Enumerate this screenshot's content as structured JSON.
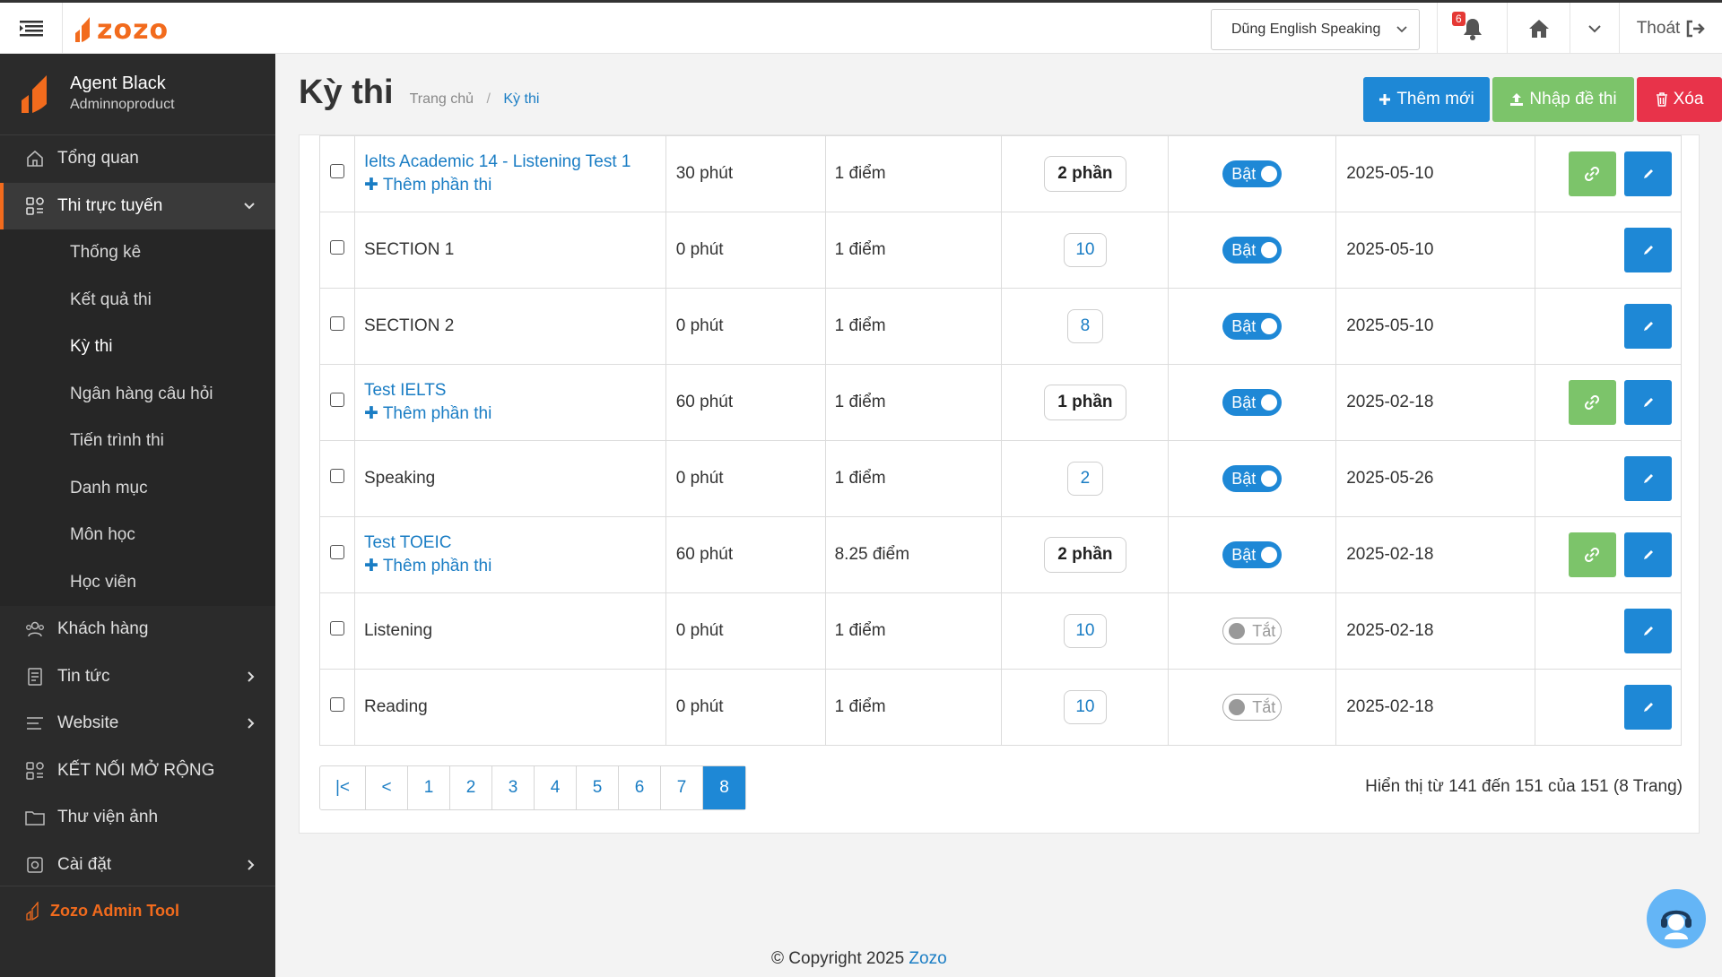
{
  "header": {
    "logo_text": "zozo",
    "site_select": "Dũng English Speaking",
    "notification_count": "6",
    "logout_label": "Thoát"
  },
  "sidebar": {
    "user_name": "Agent Black",
    "user_role": "Adminnoproduct",
    "items": [
      {
        "label": "Tổng quan"
      },
      {
        "label": "Thi trực tuyến"
      },
      {
        "label": "Khách hàng"
      },
      {
        "label": "Tin tức"
      },
      {
        "label": "Website"
      },
      {
        "label": "KẾT NỐI MỞ RỘNG"
      },
      {
        "label": "Thư viện ảnh"
      },
      {
        "label": "Cài đặt"
      }
    ],
    "sub_items": [
      {
        "label": "Thống kê"
      },
      {
        "label": "Kết quả thi"
      },
      {
        "label": "Kỳ thi"
      },
      {
        "label": "Ngân hàng câu hỏi"
      },
      {
        "label": "Tiến trình thi"
      },
      {
        "label": "Danh mục"
      },
      {
        "label": "Môn học"
      },
      {
        "label": "Học viên"
      }
    ],
    "footer_label": "Zozo Admin Tool"
  },
  "page": {
    "title": "Kỳ thi",
    "breadcrumb_home": "Trang chủ",
    "breadcrumb_sep": "/",
    "breadcrumb_current": "Kỳ thi",
    "btn_add": "Thêm mới",
    "btn_import": "Nhập đề thi",
    "btn_delete": "Xóa"
  },
  "table": {
    "add_part_label": "Thêm phần thi",
    "rows": [
      {
        "name": "Ielts Academic 14 - Listening Test 1",
        "time": "30 phút",
        "score": "1 điểm",
        "parts": "2 phần",
        "status": "Bật",
        "date": "2025-05-10"
      },
      {
        "name": "SECTION 1",
        "time": "0 phút",
        "score": "1 điểm",
        "parts": "10",
        "status": "Bật",
        "date": "2025-05-10"
      },
      {
        "name": "SECTION 2",
        "time": "0 phút",
        "score": "1 điểm",
        "parts": "8",
        "status": "Bật",
        "date": "2025-05-10"
      },
      {
        "name": "Test IELTS",
        "time": "60 phút",
        "score": "1 điểm",
        "parts": "1 phần",
        "status": "Bật",
        "date": "2025-02-18"
      },
      {
        "name": "Speaking",
        "time": "0 phút",
        "score": "1 điểm",
        "parts": "2",
        "status": "Bật",
        "date": "2025-05-26"
      },
      {
        "name": "Test TOEIC",
        "time": "60 phút",
        "score": "8.25 điểm",
        "parts": "2 phần",
        "status": "Bật",
        "date": "2025-02-18"
      },
      {
        "name": "Listening",
        "time": "0 phút",
        "score": "1 điểm",
        "parts": "10",
        "status": "Tắt",
        "date": "2025-02-18"
      },
      {
        "name": "Reading",
        "time": "0 phút",
        "score": "1 điểm",
        "parts": "10",
        "status": "Tắt",
        "date": "2025-02-18"
      }
    ]
  },
  "pagination": {
    "first": "|<",
    "prev": "<",
    "pages": [
      "1",
      "2",
      "3",
      "4",
      "5",
      "6",
      "7",
      "8"
    ],
    "current": "8",
    "info": "Hiển thị từ 141 đến 151 của 151 (8 Trang)"
  },
  "footer": {
    "copyright": "© Copyright 2025",
    "brand": "Zozo"
  },
  "colors": {
    "accent": "#f26b1d",
    "primary": "#1e88d6",
    "success": "#7cc46a",
    "danger": "#e8334a",
    "sidebar_bg": "#2b2b2b"
  }
}
